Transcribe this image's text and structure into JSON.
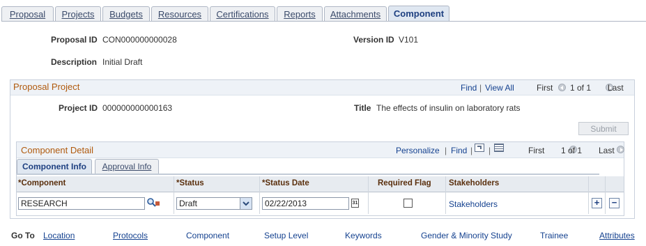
{
  "tabs": [
    {
      "label": "Proposal"
    },
    {
      "label": "Projects"
    },
    {
      "label": "Budgets"
    },
    {
      "label": "Resources"
    },
    {
      "label": "Certifications"
    },
    {
      "label": "Reports"
    },
    {
      "label": "Attachments"
    },
    {
      "label": "Component"
    }
  ],
  "header": {
    "proposal_id_label": "Proposal ID",
    "proposal_id": "CON000000000028",
    "version_id_label": "Version ID",
    "version_id": "V101",
    "description_label": "Description",
    "description": "Initial Draft"
  },
  "project_panel": {
    "title": "Proposal Project",
    "find": "Find",
    "separator": "|",
    "view_all": "View All",
    "first": "First",
    "count": "1 of 1",
    "last": "Last",
    "project_id_label": "Project ID",
    "project_id": "000000000000163",
    "title_label": "Title",
    "title_value": "The effects of insulin on laboratory rats",
    "submit": "Submit"
  },
  "component_panel": {
    "title": "Component Detail",
    "personalize": "Personalize",
    "sep1": "|",
    "find": "Find",
    "sep2": "|",
    "sep3": "|",
    "first": "First",
    "count": "1 of 1",
    "last": "Last",
    "subtabs": [
      {
        "label": "Component Info"
      },
      {
        "label": "Approval Info"
      }
    ],
    "columns": {
      "component": "*Component",
      "status": "*Status",
      "status_date": "*Status Date",
      "required": "Required Flag",
      "stakeholders": "Stakeholders"
    },
    "row": {
      "component": "RESEARCH",
      "status": "Draft",
      "status_date": "02/22/2013",
      "stakeholders": "Stakeholders",
      "add": "+",
      "remove": "−"
    }
  },
  "goto": {
    "label": "Go To",
    "links": [
      "Location",
      "Protocols",
      "Component",
      "Setup Level",
      "Keywords",
      "Gender & Minority Study",
      "Trainee",
      "Attributes"
    ]
  },
  "icons": {
    "lookup": "magnifier-icon",
    "calendar": "calendar-icon",
    "nav_prev": "prev-arrow-icon",
    "nav_next": "next-arrow-icon",
    "grid": "grid-view-icon",
    "zoom": "zoom-icon",
    "dropdown": "chevron-down-icon"
  }
}
